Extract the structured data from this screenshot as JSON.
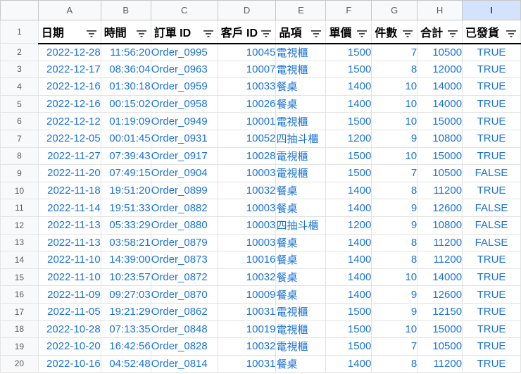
{
  "columns": [
    "A",
    "B",
    "C",
    "D",
    "E",
    "F",
    "G",
    "H",
    "I"
  ],
  "header_row_number": "1",
  "headers": [
    "日期",
    "時間",
    "訂單 ID",
    "客戶 ID",
    "品項",
    "單價",
    "件數",
    "合計",
    "已發貨"
  ],
  "rows": [
    {
      "num": "2",
      "date": "2022-12-28",
      "time": "11:56:20",
      "order": "Order_0995",
      "cust": "10045",
      "item": "電視櫃",
      "price": "1500",
      "qty": "7",
      "total": "10500",
      "shipped": "TRUE"
    },
    {
      "num": "3",
      "date": "2022-12-17",
      "time": "08:36:04",
      "order": "Order_0963",
      "cust": "10007",
      "item": "電視櫃",
      "price": "1500",
      "qty": "8",
      "total": "12000",
      "shipped": "TRUE"
    },
    {
      "num": "4",
      "date": "2022-12-16",
      "time": "01:30:18",
      "order": "Order_0959",
      "cust": "10033",
      "item": "餐桌",
      "price": "1400",
      "qty": "10",
      "total": "14000",
      "shipped": "TRUE"
    },
    {
      "num": "5",
      "date": "2022-12-16",
      "time": "00:15:02",
      "order": "Order_0958",
      "cust": "10026",
      "item": "餐桌",
      "price": "1400",
      "qty": "10",
      "total": "14000",
      "shipped": "TRUE"
    },
    {
      "num": "6",
      "date": "2022-12-12",
      "time": "01:19:09",
      "order": "Order_0949",
      "cust": "10001",
      "item": "電視櫃",
      "price": "1500",
      "qty": "10",
      "total": "15000",
      "shipped": "TRUE"
    },
    {
      "num": "7",
      "date": "2022-12-05",
      "time": "00:01:45",
      "order": "Order_0931",
      "cust": "10052",
      "item": "四抽斗櫃",
      "price": "1200",
      "qty": "9",
      "total": "10800",
      "shipped": "TRUE"
    },
    {
      "num": "8",
      "date": "2022-11-27",
      "time": "07:39:43",
      "order": "Order_0917",
      "cust": "10028",
      "item": "電視櫃",
      "price": "1500",
      "qty": "10",
      "total": "15000",
      "shipped": "TRUE"
    },
    {
      "num": "9",
      "date": "2022-11-20",
      "time": "07:49:15",
      "order": "Order_0904",
      "cust": "10003",
      "item": "電視櫃",
      "price": "1500",
      "qty": "7",
      "total": "10500",
      "shipped": "FALSE"
    },
    {
      "num": "10",
      "date": "2022-11-18",
      "time": "19:51:20",
      "order": "Order_0899",
      "cust": "10032",
      "item": "餐桌",
      "price": "1400",
      "qty": "8",
      "total": "11200",
      "shipped": "TRUE"
    },
    {
      "num": "11",
      "date": "2022-11-14",
      "time": "19:51:33",
      "order": "Order_0882",
      "cust": "10003",
      "item": "餐桌",
      "price": "1400",
      "qty": "9",
      "total": "12600",
      "shipped": "FALSE"
    },
    {
      "num": "12",
      "date": "2022-11-13",
      "time": "05:33:29",
      "order": "Order_0880",
      "cust": "10003",
      "item": "四抽斗櫃",
      "price": "1200",
      "qty": "9",
      "total": "10800",
      "shipped": "FALSE"
    },
    {
      "num": "13",
      "date": "2022-11-13",
      "time": "03:58:21",
      "order": "Order_0879",
      "cust": "10003",
      "item": "餐桌",
      "price": "1400",
      "qty": "8",
      "total": "11200",
      "shipped": "FALSE"
    },
    {
      "num": "14",
      "date": "2022-11-10",
      "time": "14:39:00",
      "order": "Order_0873",
      "cust": "10016",
      "item": "餐桌",
      "price": "1400",
      "qty": "8",
      "total": "11200",
      "shipped": "TRUE"
    },
    {
      "num": "15",
      "date": "2022-11-10",
      "time": "10:23:57",
      "order": "Order_0872",
      "cust": "10032",
      "item": "餐桌",
      "price": "1400",
      "qty": "10",
      "total": "14000",
      "shipped": "TRUE"
    },
    {
      "num": "16",
      "date": "2022-11-09",
      "time": "09:27:03",
      "order": "Order_0870",
      "cust": "10009",
      "item": "餐桌",
      "price": "1400",
      "qty": "9",
      "total": "12600",
      "shipped": "TRUE"
    },
    {
      "num": "17",
      "date": "2022-11-05",
      "time": "19:21:29",
      "order": "Order_0862",
      "cust": "10031",
      "item": "電視櫃",
      "price": "1500",
      "qty": "9",
      "total": "12150",
      "shipped": "TRUE"
    },
    {
      "num": "18",
      "date": "2022-10-28",
      "time": "07:13:35",
      "order": "Order_0848",
      "cust": "10019",
      "item": "電視櫃",
      "price": "1500",
      "qty": "10",
      "total": "15000",
      "shipped": "TRUE"
    },
    {
      "num": "19",
      "date": "2022-10-20",
      "time": "16:42:56",
      "order": "Order_0828",
      "cust": "10032",
      "item": "電視櫃",
      "price": "1500",
      "qty": "7",
      "total": "10500",
      "shipped": "TRUE"
    },
    {
      "num": "20",
      "date": "2022-10-16",
      "time": "04:52:48",
      "order": "Order_0814",
      "cust": "10031",
      "item": "餐桌",
      "price": "1400",
      "qty": "8",
      "total": "11200",
      "shipped": "TRUE"
    }
  ],
  "selected_column": "I",
  "colors": {
    "cell_text": "#1a73d9",
    "selected_header_bg": "#d3e3fd",
    "header_bg": "#f8f9fa"
  },
  "icons": {
    "filter": "filter-icon"
  }
}
